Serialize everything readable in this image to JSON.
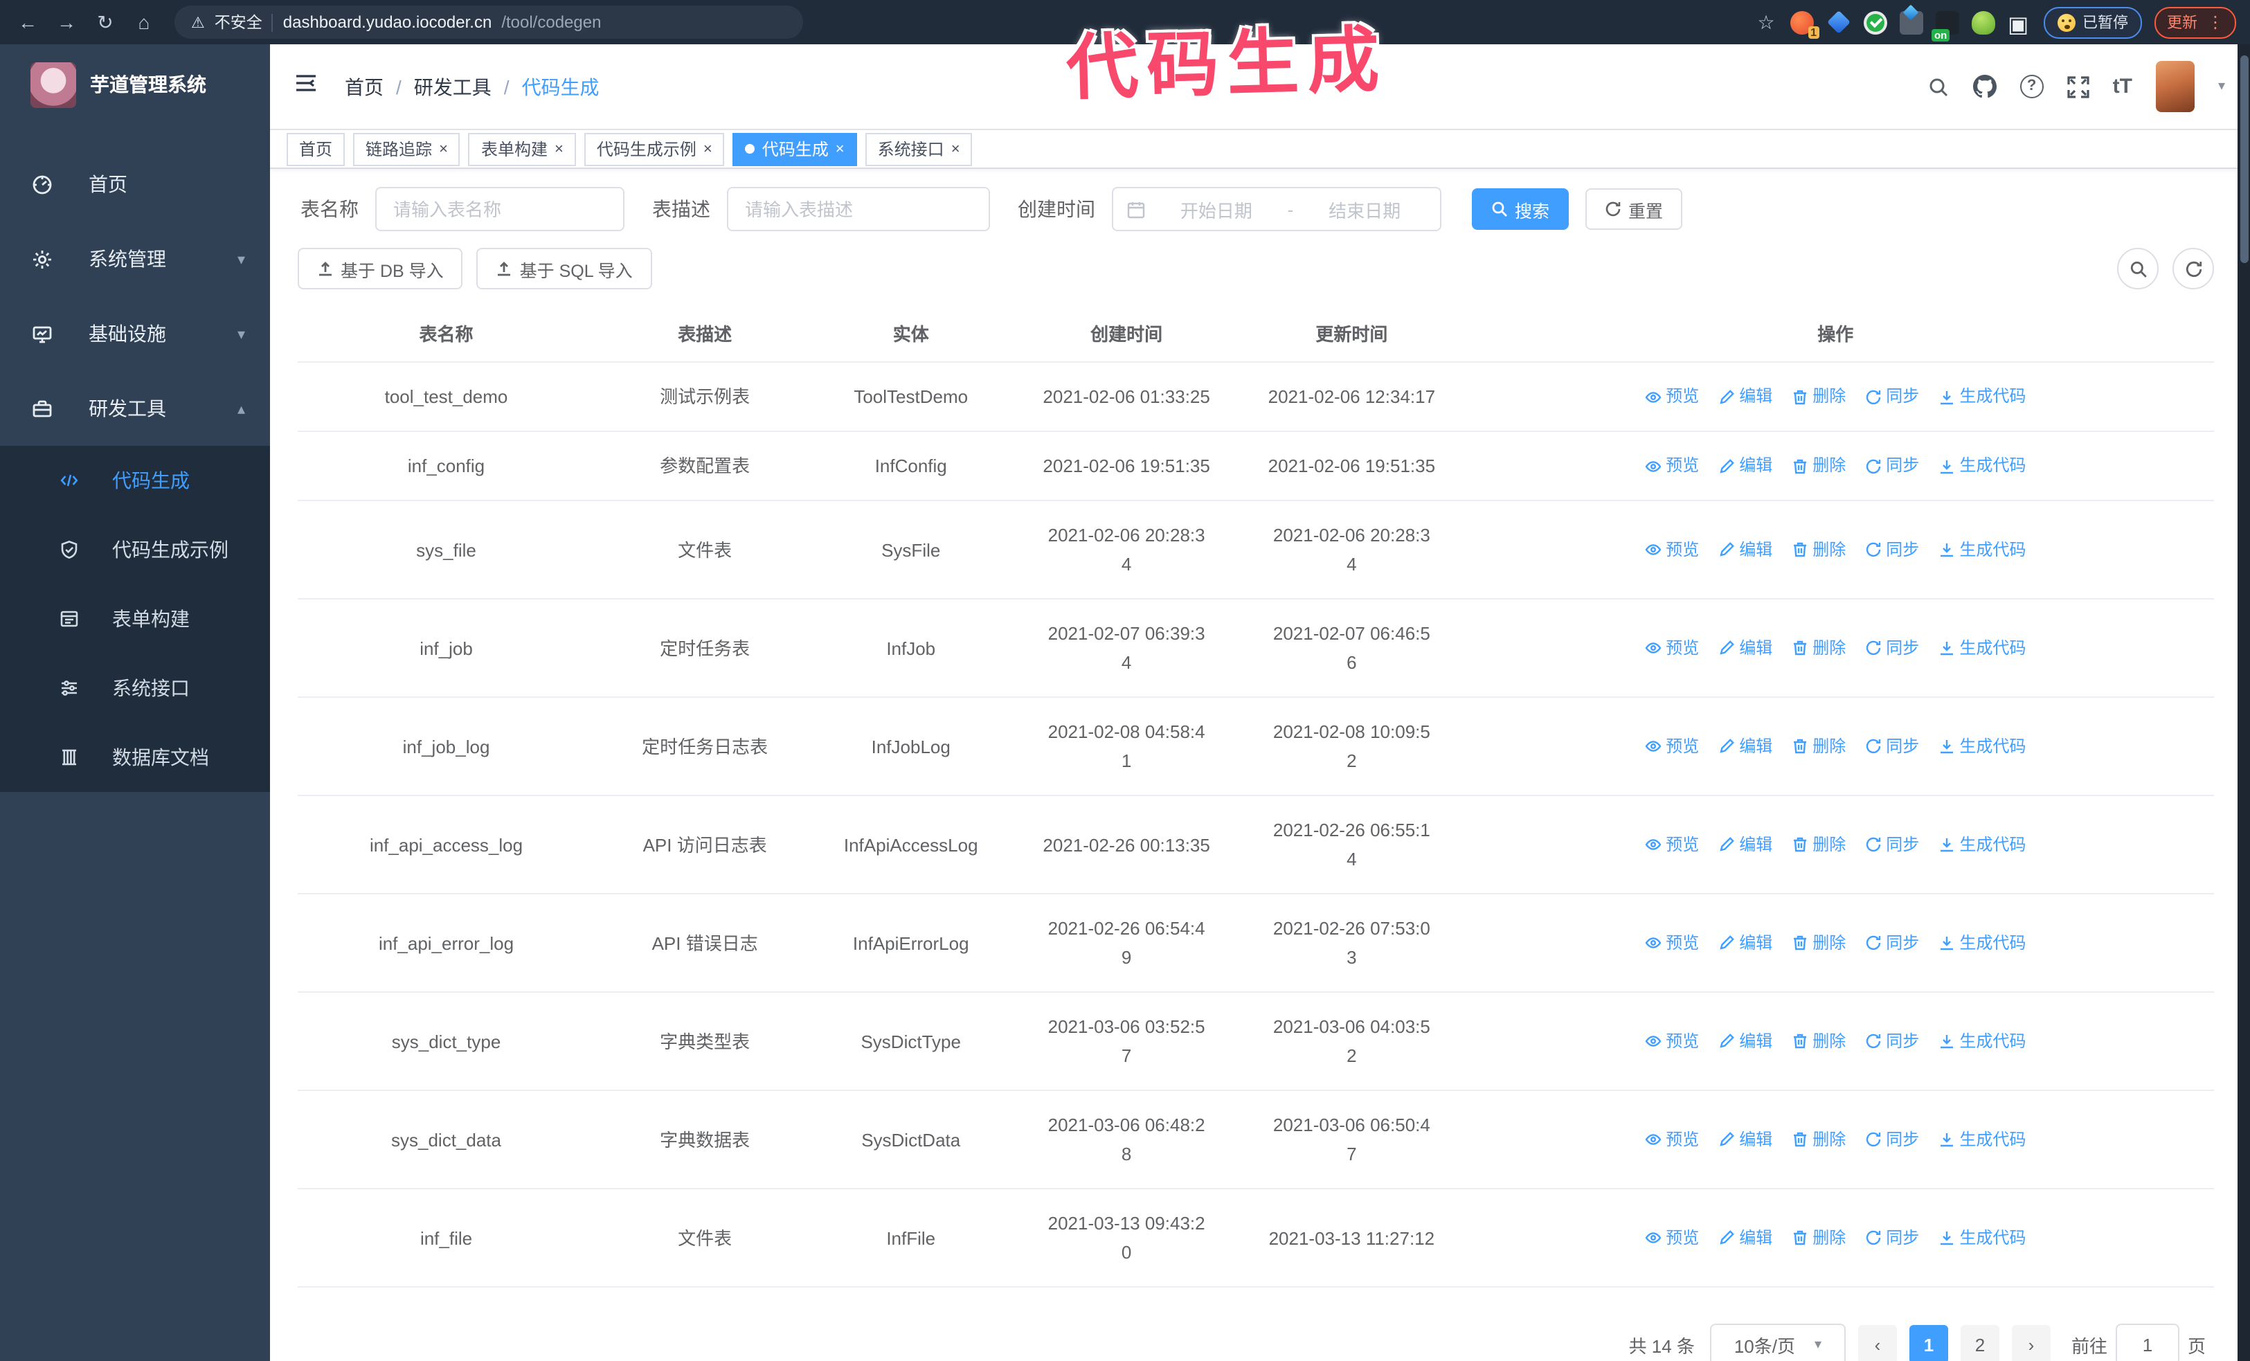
{
  "icons": {
    "back": "←",
    "forward": "→",
    "reload": "↻",
    "home": "⌂",
    "warning": "⚠",
    "star": "☆",
    "more": "⋮",
    "close": "×",
    "caret": "▾",
    "question": "?",
    "font_size": "tT",
    "slash": "/",
    "puzzle": "▣"
  },
  "browser": {
    "security_label": "不安全",
    "url_host": "dashboard.yudao.iocoder.cn",
    "url_path": "/tool/codegen",
    "extension_badge": "1",
    "extension_on_badge": "on",
    "paused_badge": "已暂停",
    "update_button": "更新"
  },
  "annotation": {
    "text": "代码生成",
    "color": "#f8486c"
  },
  "sidebar": {
    "title": "芋道管理系统",
    "items": [
      {
        "label": "首页"
      },
      {
        "label": "系统管理"
      },
      {
        "label": "基础设施"
      },
      {
        "label": "研发工具"
      }
    ],
    "subitems": [
      {
        "label": "代码生成",
        "active": true
      },
      {
        "label": "代码生成示例"
      },
      {
        "label": "表单构建"
      },
      {
        "label": "系统接口"
      },
      {
        "label": "数据库文档"
      }
    ]
  },
  "header": {
    "breadcrumb": [
      "首页",
      "研发工具",
      "代码生成"
    ],
    "separator": "/"
  },
  "tags": [
    {
      "label": "首页",
      "closable": false,
      "active": false
    },
    {
      "label": "链路追踪",
      "closable": true,
      "active": false
    },
    {
      "label": "表单构建",
      "closable": true,
      "active": false
    },
    {
      "label": "代码生成示例",
      "closable": true,
      "active": false
    },
    {
      "label": "代码生成",
      "closable": true,
      "active": true
    },
    {
      "label": "系统接口",
      "closable": true,
      "active": false
    }
  ],
  "filters": {
    "name_label": "表名称",
    "name_placeholder": "请输入表名称",
    "desc_label": "表描述",
    "desc_placeholder": "请输入表描述",
    "time_label": "创建时间",
    "start_placeholder": "开始日期",
    "range_separator": "-",
    "end_placeholder": "结束日期",
    "search_label": "搜索",
    "reset_label": "重置"
  },
  "toolbar": {
    "import_db_label": "基于 DB 导入",
    "import_sql_label": "基于 SQL 导入"
  },
  "table": {
    "columns": [
      "表名称",
      "表描述",
      "实体",
      "创建时间",
      "更新时间",
      "操作"
    ],
    "actions": [
      "预览",
      "编辑",
      "删除",
      "同步",
      "生成代码"
    ],
    "rows": [
      {
        "name": "tool_test_demo",
        "desc": "测试示例表",
        "entity": "ToolTestDemo",
        "created": "2021-02-06 01:33:25",
        "updated": "2021-02-06 12:34:17"
      },
      {
        "name": "inf_config",
        "desc": "参数配置表",
        "entity": "InfConfig",
        "created": "2021-02-06 19:51:35",
        "updated": "2021-02-06 19:51:35"
      },
      {
        "name": "sys_file",
        "desc": "文件表",
        "entity": "SysFile",
        "created": "2021-02-06 20:28:3\n4",
        "updated": "2021-02-06 20:28:3\n4"
      },
      {
        "name": "inf_job",
        "desc": "定时任务表",
        "entity": "InfJob",
        "created": "2021-02-07 06:39:3\n4",
        "updated": "2021-02-07 06:46:5\n6"
      },
      {
        "name": "inf_job_log",
        "desc": "定时任务日志表",
        "entity": "InfJobLog",
        "created": "2021-02-08 04:58:4\n1",
        "updated": "2021-02-08 10:09:5\n2"
      },
      {
        "name": "inf_api_access_log",
        "desc": "API 访问日志表",
        "entity": "InfApiAccessLog",
        "created": "2021-02-26 00:13:35",
        "updated": "2021-02-26 06:55:1\n4"
      },
      {
        "name": "inf_api_error_log",
        "desc": "API 错误日志",
        "entity": "InfApiErrorLog",
        "created": "2021-02-26 06:54:4\n9",
        "updated": "2021-02-26 07:53:0\n3"
      },
      {
        "name": "sys_dict_type",
        "desc": "字典类型表",
        "entity": "SysDictType",
        "created": "2021-03-06 03:52:5\n7",
        "updated": "2021-03-06 04:03:5\n2"
      },
      {
        "name": "sys_dict_data",
        "desc": "字典数据表",
        "entity": "SysDictData",
        "created": "2021-03-06 06:48:2\n8",
        "updated": "2021-03-06 06:50:4\n7"
      },
      {
        "name": "inf_file",
        "desc": "文件表",
        "entity": "InfFile",
        "created": "2021-03-13 09:43:2\n0",
        "updated": "2021-03-13 11:27:12"
      }
    ]
  },
  "pagination": {
    "total": "共 14 条",
    "page_size": "10条/页",
    "prev": "‹",
    "next": "›",
    "pages": [
      "1",
      "2"
    ],
    "active_page": "1",
    "goto_label": "前往",
    "goto_value": "1",
    "page_suffix": "页"
  }
}
